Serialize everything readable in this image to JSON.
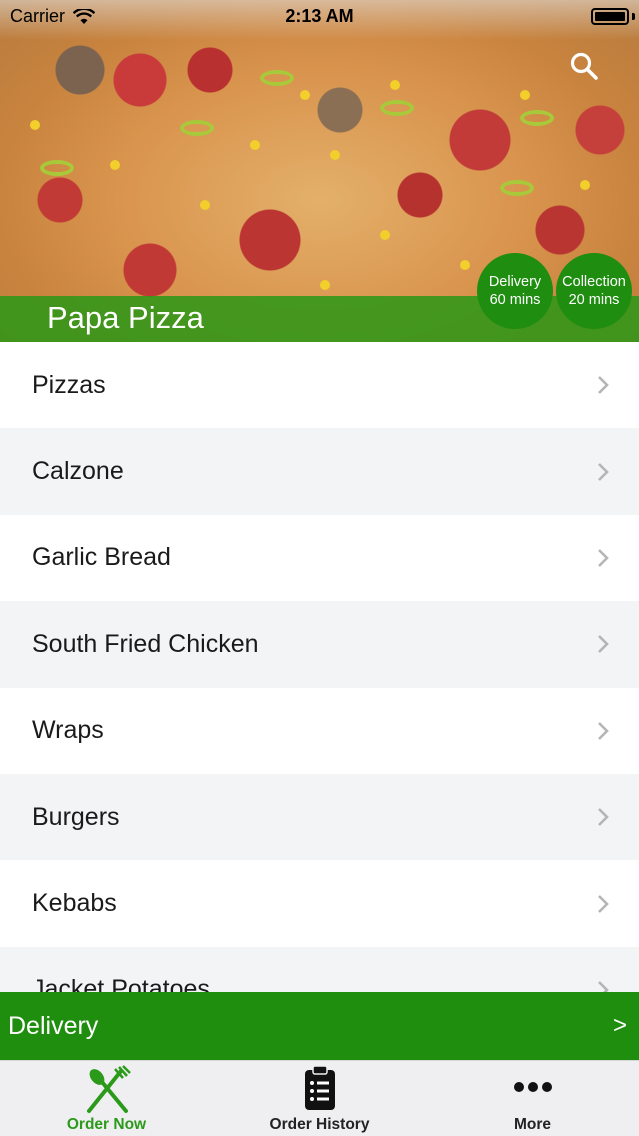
{
  "status_bar": {
    "carrier": "Carrier",
    "time": "2:13 AM"
  },
  "header": {
    "restaurant_name": "Papa Pizza",
    "delivery_badge": {
      "label": "Delivery",
      "time": "60 mins"
    },
    "collection_badge": {
      "label": "Collection",
      "time": "20 mins"
    },
    "search_icon": "search-icon"
  },
  "menu": {
    "items": [
      {
        "label": "Pizzas"
      },
      {
        "label": "Calzone"
      },
      {
        "label": "Garlic Bread"
      },
      {
        "label": "South Fried Chicken"
      },
      {
        "label": "Wraps"
      },
      {
        "label": "Burgers"
      },
      {
        "label": "Kebabs"
      },
      {
        "label": "Jacket Potatoes"
      }
    ]
  },
  "delivery_bar": {
    "label": "Delivery",
    "arrow": ">"
  },
  "tabs": [
    {
      "label": "Order Now",
      "icon": "cutlery-icon",
      "active": true
    },
    {
      "label": "Order History",
      "icon": "clipboard-icon",
      "active": false
    },
    {
      "label": "More",
      "icon": "more-icon",
      "active": false
    }
  ],
  "colors": {
    "brand_green": "#1f8d0d",
    "active_tab": "#2b9a1a",
    "alt_row": "#f3f4f6"
  }
}
